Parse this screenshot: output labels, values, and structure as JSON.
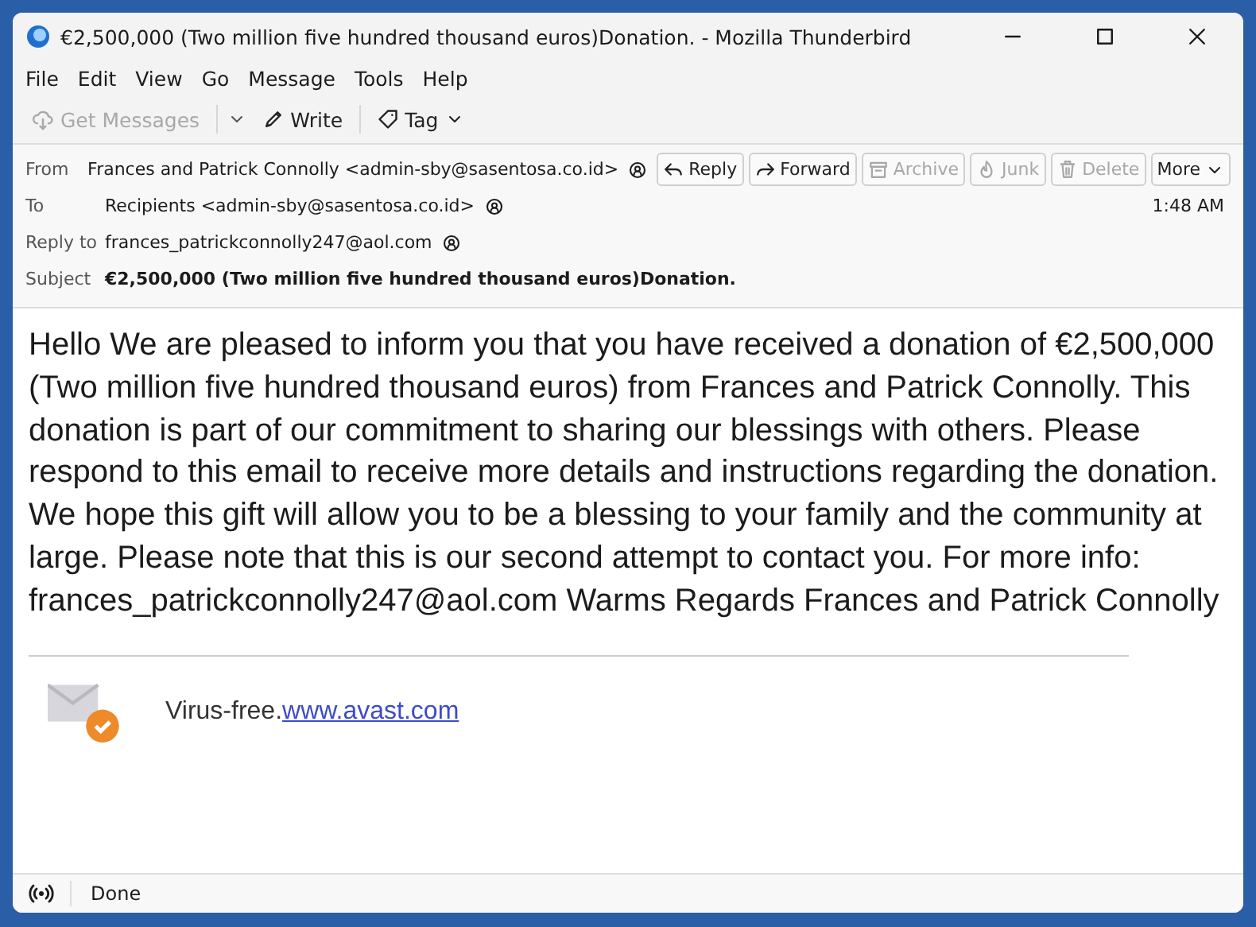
{
  "window": {
    "title": "€2,500,000 (Two million five hundred thousand euros)Donation. - Mozilla Thunderbird"
  },
  "menu": [
    "File",
    "Edit",
    "View",
    "Go",
    "Message",
    "Tools",
    "Help"
  ],
  "toolbar": [
    {
      "kind": "get",
      "label": "Get Messages",
      "disabled": true
    },
    {
      "kind": "write",
      "label": "Write",
      "disabled": false
    },
    {
      "kind": "tag",
      "label": "Tag",
      "disabled": false
    }
  ],
  "header": {
    "fields": [
      {
        "label": "From",
        "value": "Frances and Patrick Connolly <admin-sby@sasentosa.co.id>",
        "bold": false
      },
      {
        "label": "To",
        "value": "Recipients <admin-sby@sasentosa.co.id>",
        "bold": false
      },
      {
        "label": "Reply to",
        "value": "frances_patrickconnolly247@aol.com",
        "bold": false
      },
      {
        "label": "Subject",
        "value": "€2,500,000 (Two million five hundred thousand euros)Donation.",
        "bold": true
      }
    ],
    "actions": [
      {
        "kind": "reply",
        "label": "Reply",
        "disabled": false
      },
      {
        "kind": "forward",
        "label": "Forward",
        "disabled": false
      },
      {
        "kind": "archive",
        "label": "Archive",
        "disabled": true
      },
      {
        "kind": "junk",
        "label": "Junk",
        "disabled": true
      },
      {
        "kind": "delete",
        "label": "Delete",
        "disabled": true
      },
      {
        "kind": "more",
        "label": "More",
        "disabled": false
      }
    ],
    "time": "1:48 AM"
  },
  "body": "Hello We are pleased to inform you that you have received a donation of €2,500,000 (Two million five hundred thousand euros) from Frances and Patrick Connolly. This donation is part of our commitment to sharing our blessings with others. Please respond to this email to receive more details and instructions regarding the donation. We hope this gift will allow you to be a blessing to your family and the community at large. Please note that this is our second attempt to contact you. For more info: frances_patrickconnolly247@aol.com Warms Regards Frances and Patrick Connolly",
  "signature": {
    "text": "Virus-free.",
    "link": "www.avast.com"
  },
  "status_bar": {
    "text": "Done"
  }
}
